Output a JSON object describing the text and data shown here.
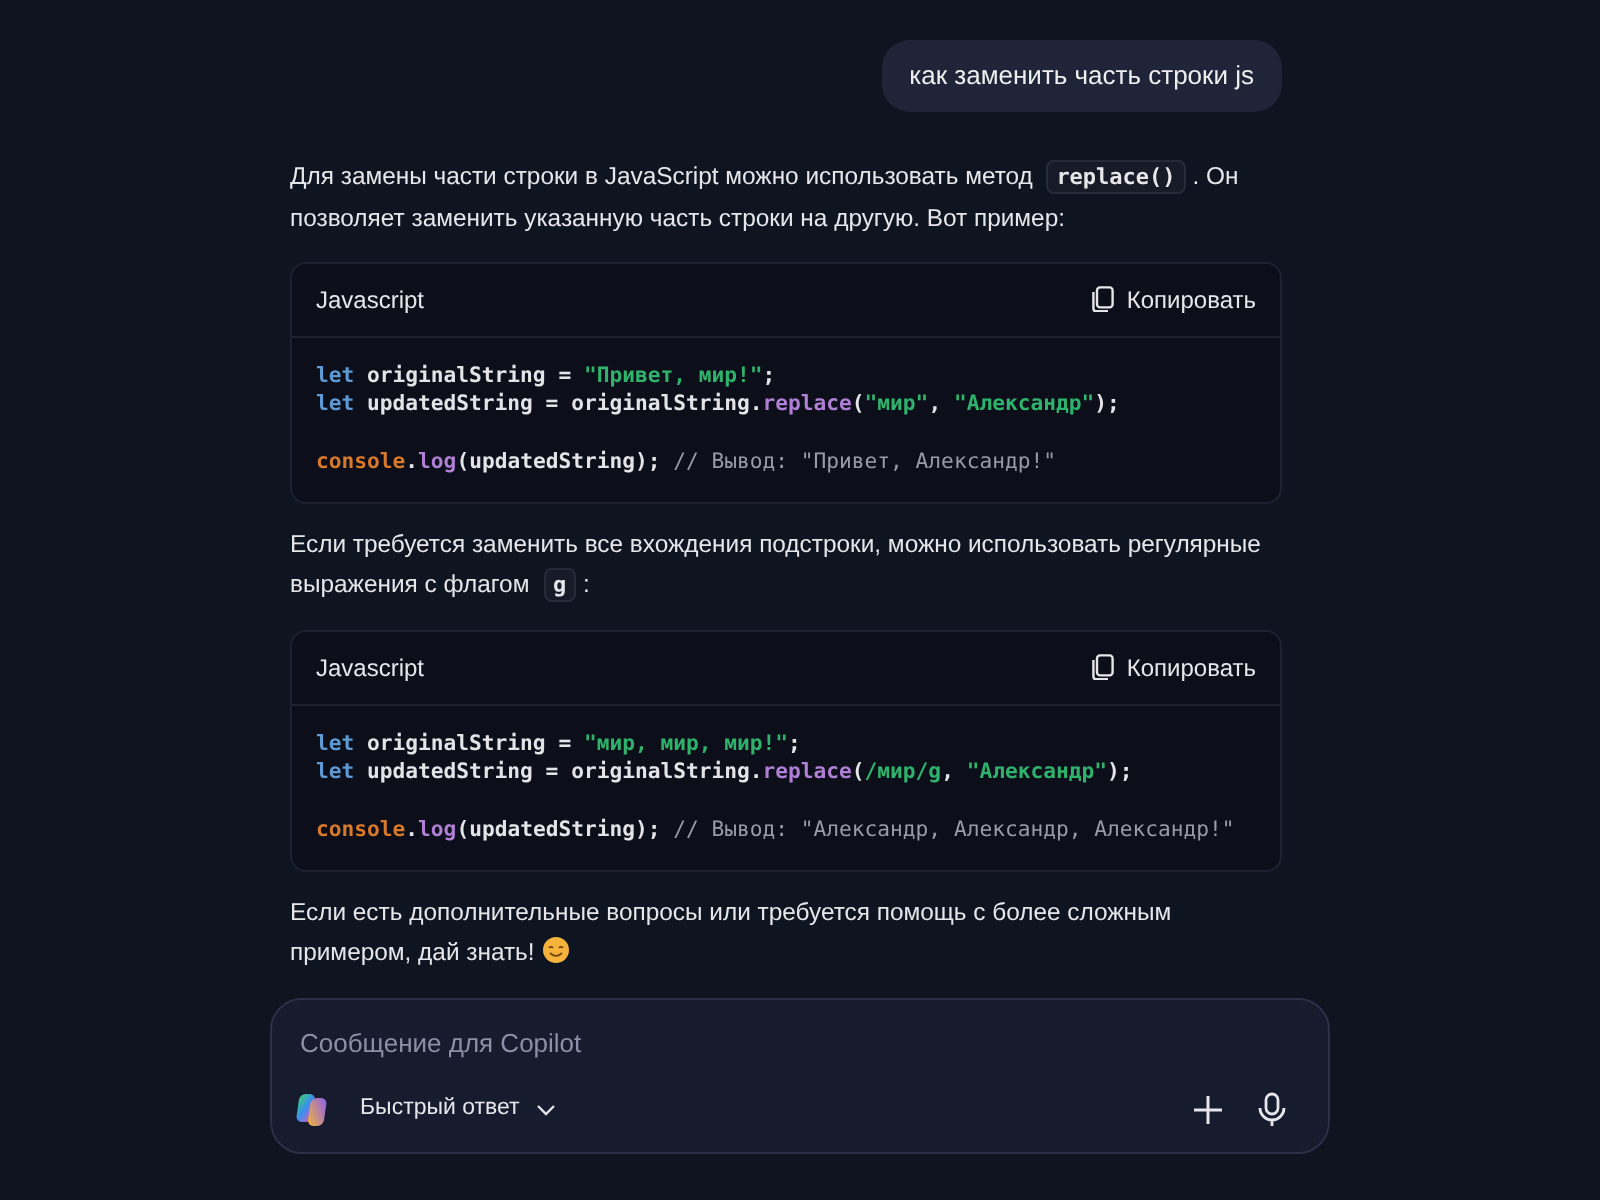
{
  "user_message": "как заменить часть строки js",
  "reply": [
    {
      "kind": "paragraph",
      "segments": [
        {
          "kind": "text",
          "text": "Для замены части строки в JavaScript можно использовать метод "
        },
        {
          "kind": "code",
          "text": "replace()"
        },
        {
          "kind": "text",
          "text": ". Он позволяет заменить указанную часть строки на другую. Вот пример:"
        }
      ]
    },
    {
      "kind": "code_block",
      "language": "Javascript",
      "copy_label": "Копировать",
      "lines": [
        {
          "kind": "code",
          "tokens": [
            {
              "kind": "keyword",
              "text": "let"
            },
            {
              "kind": "plain",
              "text": " originalString = "
            },
            {
              "kind": "string",
              "text": "\"Привет, мир!\""
            },
            {
              "kind": "plain",
              "text": ";"
            }
          ]
        },
        {
          "kind": "code",
          "tokens": [
            {
              "kind": "keyword",
              "text": "let"
            },
            {
              "kind": "plain",
              "text": " updatedString = originalString."
            },
            {
              "kind": "func",
              "text": "replace"
            },
            {
              "kind": "plain",
              "text": "("
            },
            {
              "kind": "string",
              "text": "\"мир\""
            },
            {
              "kind": "plain",
              "text": ", "
            },
            {
              "kind": "string",
              "text": "\"Александр\""
            },
            {
              "kind": "plain",
              "text": ");"
            }
          ]
        },
        {
          "kind": "blank"
        },
        {
          "kind": "code",
          "tokens": [
            {
              "kind": "object",
              "text": "console"
            },
            {
              "kind": "plain",
              "text": "."
            },
            {
              "kind": "func",
              "text": "log"
            },
            {
              "kind": "plain",
              "text": "(updatedString); "
            },
            {
              "kind": "comment",
              "text": "// Вывод: \"Привет, Александр!\""
            }
          ]
        }
      ]
    },
    {
      "kind": "paragraph",
      "segments": [
        {
          "kind": "text",
          "text": "Если требуется заменить все вхождения подстроки, можно использовать регулярные выражения с флагом "
        },
        {
          "kind": "code",
          "text": "g"
        },
        {
          "kind": "text",
          "text": ":"
        }
      ]
    },
    {
      "kind": "code_block",
      "language": "Javascript",
      "copy_label": "Копировать",
      "lines": [
        {
          "kind": "code",
          "tokens": [
            {
              "kind": "keyword",
              "text": "let"
            },
            {
              "kind": "plain",
              "text": " originalString = "
            },
            {
              "kind": "string",
              "text": "\"мир, мир, мир!\""
            },
            {
              "kind": "plain",
              "text": ";"
            }
          ]
        },
        {
          "kind": "code",
          "tokens": [
            {
              "kind": "keyword",
              "text": "let"
            },
            {
              "kind": "plain",
              "text": " updatedString = originalString."
            },
            {
              "kind": "func",
              "text": "replace"
            },
            {
              "kind": "plain",
              "text": "("
            },
            {
              "kind": "string",
              "text": "/мир/g"
            },
            {
              "kind": "plain",
              "text": ", "
            },
            {
              "kind": "string",
              "text": "\"Александр\""
            },
            {
              "kind": "plain",
              "text": ");"
            }
          ]
        },
        {
          "kind": "blank"
        },
        {
          "kind": "code",
          "tokens": [
            {
              "kind": "object",
              "text": "console"
            },
            {
              "kind": "plain",
              "text": "."
            },
            {
              "kind": "func",
              "text": "log"
            },
            {
              "kind": "plain",
              "text": "(updatedString); "
            },
            {
              "kind": "comment",
              "text": "// Вывод: \"Александр, Александр, Александр!\""
            }
          ]
        }
      ]
    },
    {
      "kind": "paragraph",
      "segments": [
        {
          "kind": "text",
          "text": "Если есть дополнительные вопросы или требуется помощь с более сложным примером, дай знать!"
        },
        {
          "kind": "emoji"
        }
      ]
    }
  ],
  "composer": {
    "placeholder": "Сообщение для Copilot",
    "mode_label": "Быстрый ответ"
  }
}
